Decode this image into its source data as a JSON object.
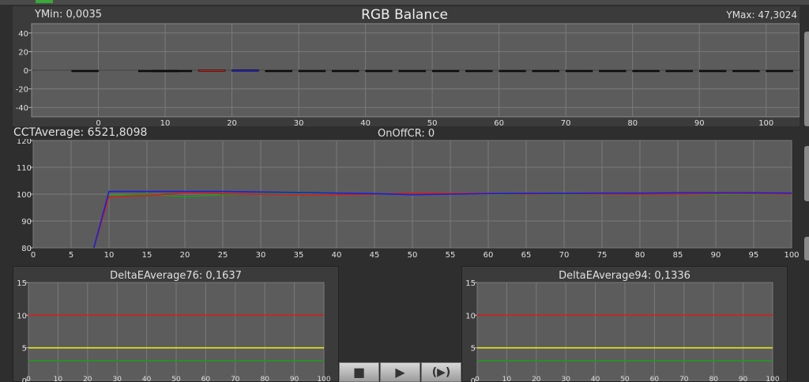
{
  "top_chart": {
    "title": "RGB Balance",
    "ymin_label": "YMin: 0,0035",
    "ymax_label": "YMax: 47,3024"
  },
  "mid_chart": {
    "cct_label": "CCTAverage: 6521,8098",
    "onoff_label": "OnOffCR: 0"
  },
  "delta76": {
    "title": "DeltaEAverage76: 0,1637"
  },
  "delta94": {
    "title": "DeltaEAverage94: 0,1336"
  },
  "controls": {
    "stop": "■",
    "play": "▶",
    "play_loop": "(▶)"
  },
  "colors": {
    "red": "#d21e1e",
    "green": "#1e9a1e",
    "blue": "#1e1ed8",
    "yellow": "#e8e81e"
  },
  "chart_data": [
    {
      "type": "bar",
      "ylim": [
        -50,
        50
      ],
      "yticks": [
        40,
        20,
        0,
        -20,
        -40
      ],
      "xlim": [
        -10,
        105
      ],
      "xticks": [
        0,
        10,
        20,
        30,
        40,
        50,
        60,
        70,
        80,
        90,
        100
      ],
      "grid": true,
      "bars": [
        {
          "x": -2,
          "y": -0.4,
          "color": "#111111"
        },
        {
          "x": 8,
          "y": -0.8,
          "color": "#111111"
        },
        {
          "x": 10,
          "y": -0.5,
          "color": "#111111"
        },
        {
          "x": 12,
          "y": -0.4,
          "color": "#111111"
        },
        {
          "x": 17,
          "y": 0.6,
          "color": "#d21e1e"
        },
        {
          "x": 22,
          "y": 0.6,
          "color": "#1e1ed8"
        },
        {
          "x": 27,
          "y": -0.3,
          "color": "#111111"
        },
        {
          "x": 32,
          "y": -0.4,
          "color": "#111111"
        },
        {
          "x": 37,
          "y": -0.3,
          "color": "#111111"
        },
        {
          "x": 42,
          "y": -0.4,
          "color": "#111111"
        },
        {
          "x": 47,
          "y": -0.5,
          "color": "#111111"
        },
        {
          "x": 52,
          "y": -0.3,
          "color": "#111111"
        },
        {
          "x": 57,
          "y": -0.3,
          "color": "#111111"
        },
        {
          "x": 62,
          "y": -0.4,
          "color": "#111111"
        },
        {
          "x": 67,
          "y": -0.3,
          "color": "#111111"
        },
        {
          "x": 72,
          "y": -0.3,
          "color": "#111111"
        },
        {
          "x": 77,
          "y": -0.3,
          "color": "#111111"
        },
        {
          "x": 82,
          "y": -0.3,
          "color": "#111111"
        },
        {
          "x": 87,
          "y": -0.4,
          "color": "#111111"
        },
        {
          "x": 92,
          "y": -0.4,
          "color": "#111111"
        },
        {
          "x": 97,
          "y": -0.3,
          "color": "#111111"
        },
        {
          "x": 102,
          "y": -0.3,
          "color": "#111111"
        }
      ]
    },
    {
      "type": "line",
      "ylim": [
        80,
        120
      ],
      "yticks": [
        120,
        110,
        100,
        90,
        80
      ],
      "xlim": [
        0,
        100
      ],
      "xticks": [
        0,
        5,
        10,
        15,
        20,
        25,
        30,
        35,
        40,
        45,
        50,
        55,
        60,
        65,
        70,
        75,
        80,
        85,
        90,
        95,
        100
      ],
      "grid": true,
      "series": [
        {
          "color": "#1e9a1e",
          "x": [
            8,
            10,
            15,
            20,
            25,
            30,
            35,
            40,
            45,
            50,
            55,
            60,
            65,
            70,
            75,
            80,
            85,
            90,
            95,
            100
          ],
          "y": [
            80,
            99.5,
            100,
            99,
            99.8,
            100.2,
            100.2,
            100,
            100,
            100.3,
            100.4,
            100.2,
            100,
            100,
            100,
            100,
            100,
            99.9,
            100,
            100.1
          ]
        },
        {
          "color": "#d21e1e",
          "x": [
            8,
            10,
            15,
            20,
            25,
            30,
            35,
            40,
            45,
            50,
            55,
            60,
            65,
            70,
            75,
            80,
            85,
            90,
            95,
            100
          ],
          "y": [
            80,
            99,
            99.5,
            100.4,
            100.2,
            100,
            99.8,
            99.8,
            100,
            100.4,
            100.3,
            100.3,
            100.1,
            100.2,
            100.1,
            100,
            100,
            100.2,
            100.2,
            100.1
          ]
        },
        {
          "color": "#1e1ed8",
          "x": [
            8,
            10,
            15,
            20,
            25,
            30,
            35,
            40,
            45,
            50,
            55,
            60,
            65,
            70,
            75,
            80,
            85,
            90,
            95,
            100
          ],
          "y": [
            80,
            101,
            101,
            101,
            101,
            100.8,
            100.6,
            100.4,
            100.2,
            99.8,
            100,
            100.2,
            100.3,
            100.3,
            100.4,
            100.4,
            100.5,
            100.5,
            100.5,
            100.4
          ]
        }
      ]
    },
    {
      "type": "line",
      "ylim": [
        0,
        15
      ],
      "yticks": [
        15,
        10,
        5,
        0
      ],
      "xlim": [
        0,
        100
      ],
      "xticks": [
        0,
        10,
        20,
        30,
        40,
        50,
        60,
        70,
        80,
        90,
        100
      ],
      "grid": true,
      "hlines": [
        {
          "y": 10,
          "color": "#d21e1e"
        },
        {
          "y": 5,
          "color": "#e8e81e"
        },
        {
          "y": 3,
          "color": "#1e9a1e"
        }
      ]
    },
    {
      "type": "line",
      "ylim": [
        0,
        15
      ],
      "yticks": [
        15,
        10,
        5,
        0
      ],
      "xlim": [
        0,
        100
      ],
      "xticks": [
        0,
        10,
        20,
        30,
        40,
        50,
        60,
        70,
        80,
        90,
        100
      ],
      "grid": true,
      "hlines": [
        {
          "y": 10,
          "color": "#d21e1e"
        },
        {
          "y": 5,
          "color": "#e8e81e"
        },
        {
          "y": 3,
          "color": "#1e9a1e"
        }
      ]
    }
  ]
}
